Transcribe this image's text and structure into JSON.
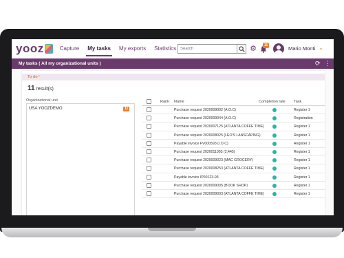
{
  "app": {
    "logo_text": "yooz",
    "brand_color": "#6a3a6c",
    "accent_color": "#e8802d"
  },
  "nav": {
    "items": [
      {
        "label": "Capture",
        "active": false
      },
      {
        "label": "My tasks",
        "active": true
      },
      {
        "label": "My exports",
        "active": false
      },
      {
        "label": "Statistics",
        "active": false
      }
    ],
    "search_placeholder": "Search",
    "notification_count": "11",
    "user_name": "Mario Monti"
  },
  "band": {
    "title": "My tasks ( All my organizational units )"
  },
  "todo": {
    "label": "To do"
  },
  "results": {
    "count": "11",
    "suffix": " result(s)"
  },
  "org": {
    "label": "Organizational unit",
    "items": [
      {
        "name": "USA YOOZDEMO",
        "count": "11"
      }
    ]
  },
  "table": {
    "headers": {
      "rank": "Rank",
      "name": "Name",
      "completion": "Completion rate",
      "task": "Task"
    },
    "status_color": "#2bb5a3",
    "rows": [
      {
        "name": "Purchase request 2020009002 (A.O.C)",
        "task": "Register 1"
      },
      {
        "name": "Purchase request 2020009044 (A.O.C)",
        "task": "Registration"
      },
      {
        "name": "Purchase request 2020007125 (ATLANTA COFFE TIME)",
        "task": "Register 1"
      },
      {
        "name": "Purchase request 2020008025 (LEO'S LANSCAPING)",
        "task": "Register 1"
      },
      {
        "name": "Payable invoice FV000593 (I.O.C)",
        "task": "Register 1"
      },
      {
        "name": "Purchase request 2020011003 (2,445)",
        "task": "Register 1"
      },
      {
        "name": "Purchase request 2020009023 (MAC GROCERY)",
        "task": "Register 1"
      },
      {
        "name": "Purchase request 2020008253 (ATLANTA COFFE TIME)",
        "task": "Register 1"
      },
      {
        "name": "Payable invoice IP00123-93",
        "task": "Register 1"
      },
      {
        "name": "Purchase request 2020009005 (BOOK SHOP)",
        "task": "Register 1"
      },
      {
        "name": "Purchase request 2020009003 (ATLANTA COFFE TIME)",
        "task": "Register 1"
      }
    ]
  }
}
